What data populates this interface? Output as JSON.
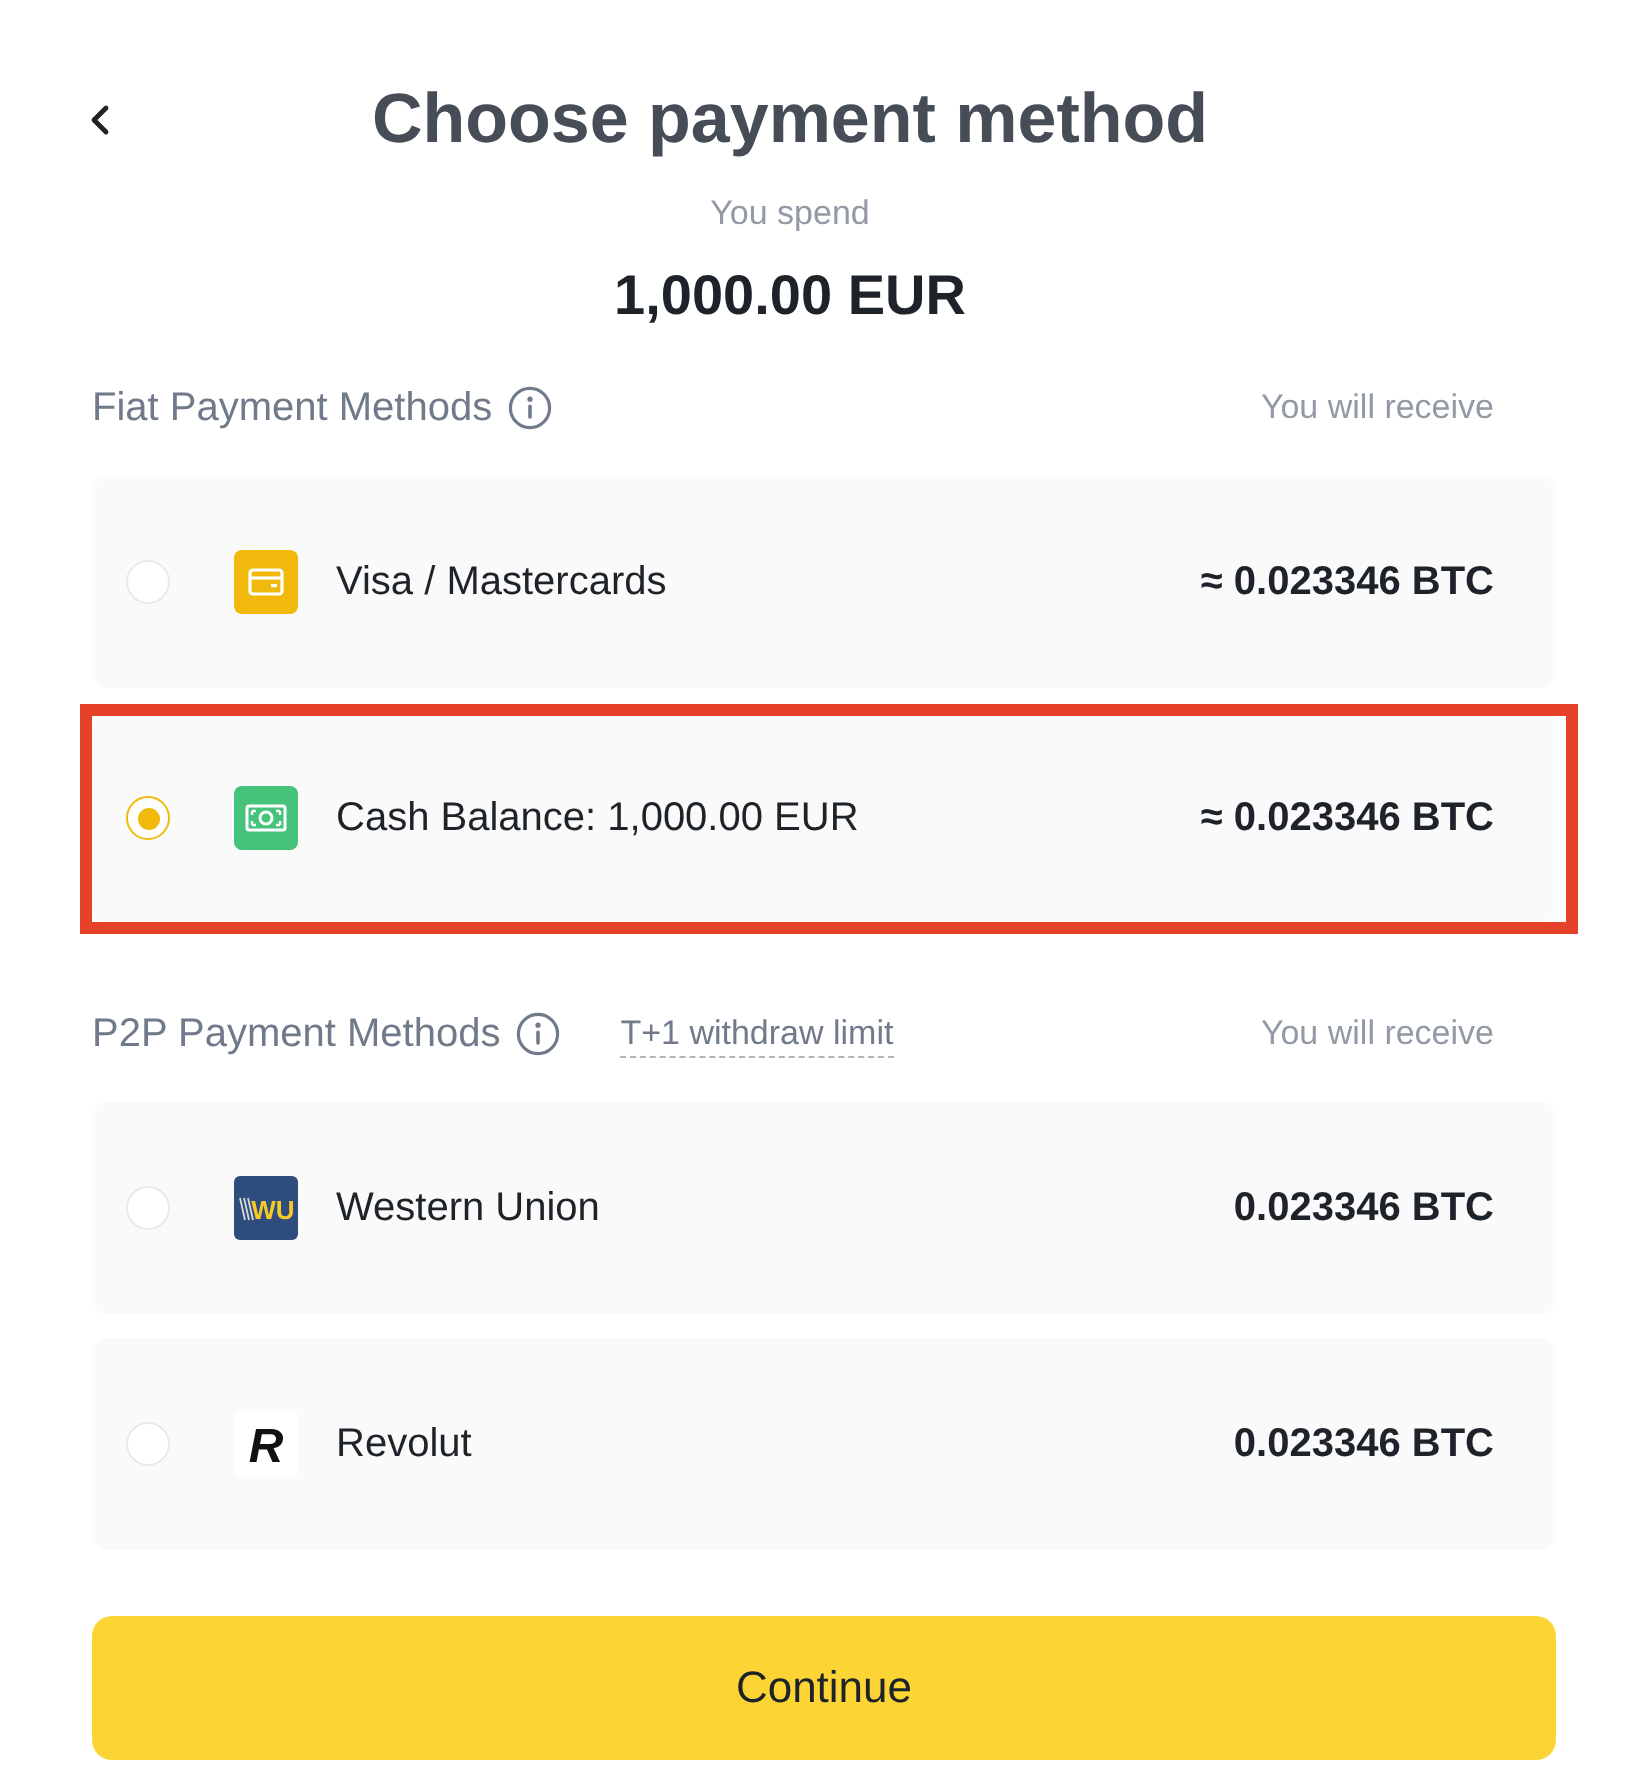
{
  "header": {
    "title": "Choose payment method"
  },
  "spend": {
    "label": "You spend",
    "amount": "1,000.00 EUR"
  },
  "sections": [
    {
      "title": "Fiat Payment Methods",
      "receive_label": "You will receive",
      "methods": [
        {
          "name": "Visa / Mastercards",
          "logo": {
            "kind": "card"
          },
          "receive": "≈ 0.023346 BTC",
          "selected": false,
          "highlighted": false
        },
        {
          "name": "Cash Balance: 1,000.00 EUR",
          "logo": {
            "kind": "cash"
          },
          "receive": "≈ 0.023346 BTC",
          "selected": true,
          "highlighted": true
        }
      ]
    },
    {
      "title": "P2P Payment Methods",
      "note": "T+1 withdraw limit",
      "receive_label": "You will receive",
      "methods": [
        {
          "name": "Western Union",
          "logo": {
            "kind": "wu",
            "text": "WU"
          },
          "receive": "0.023346 BTC",
          "selected": false,
          "highlighted": false
        },
        {
          "name": "Revolut",
          "logo": {
            "kind": "revolut",
            "text": "R"
          },
          "receive": "0.023346 BTC",
          "selected": false,
          "highlighted": false
        }
      ]
    }
  ],
  "continue_button": "Continue"
}
